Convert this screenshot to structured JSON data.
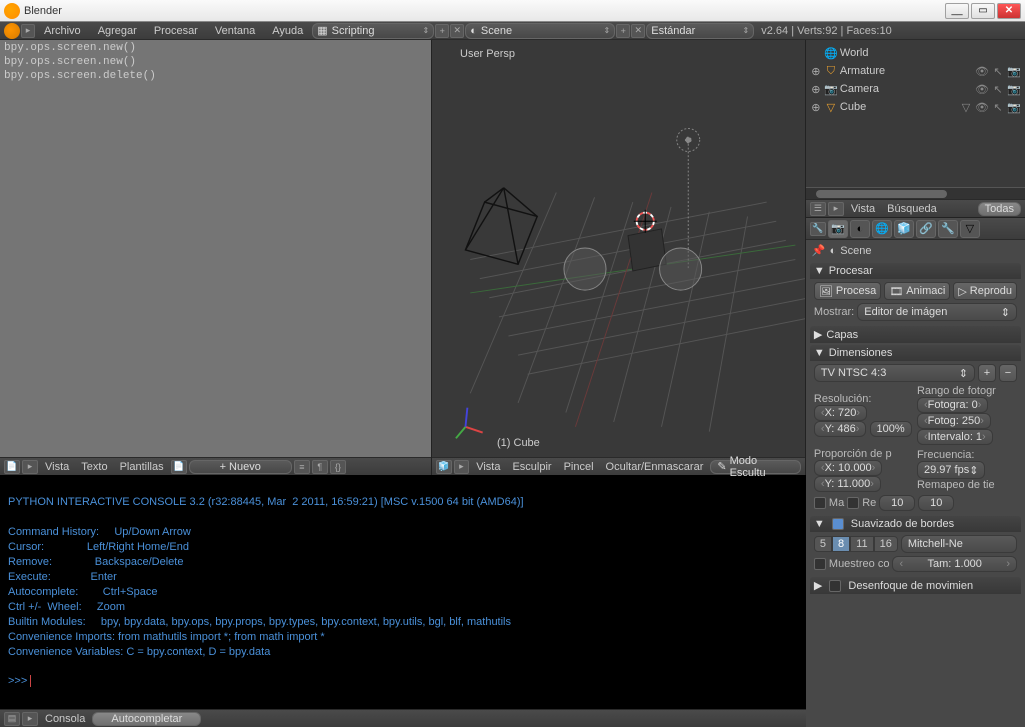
{
  "title": "Blender",
  "menus": {
    "archivo": "Archivo",
    "agregar": "Agregar",
    "procesar": "Procesar",
    "ventana": "Ventana",
    "ayuda": "Ayuda"
  },
  "topbar": {
    "layout": "Scripting",
    "scene": "Scene",
    "engine": "Estándar",
    "stats": "v2.64 | Verts:92 | Faces:10"
  },
  "script_lines": "bpy.ops.screen.new()\nbpy.ops.screen.new()\nbpy.ops.screen.delete()",
  "view3d": {
    "persp": "User Persp",
    "obj": "(1) Cube",
    "menus": {
      "vista": "Vista",
      "esculpir": "Esculpir",
      "pincel": "Pincel",
      "ocultar": "Ocultar/Enmascarar"
    },
    "mode": "Modo Escultu"
  },
  "texteditor_menus": {
    "vista": "Vista",
    "texto": "Texto",
    "plantillas": "Plantillas",
    "nuevo": "Nuevo"
  },
  "console_text": "PYTHON INTERACTIVE CONSOLE 3.2 (r32:88445, Mar  2 2011, 16:59:21) [MSC v.1500 64 bit (AMD64)]\n\nCommand History:     Up/Down Arrow\nCursor:              Left/Right Home/End\nRemove:              Backspace/Delete\nExecute:             Enter\nAutocomplete:        Ctrl+Space\nCtrl +/-  Wheel:     Zoom\nBuiltin Modules:     bpy, bpy.data, bpy.ops, bpy.props, bpy.types, bpy.context, bpy.utils, bgl, blf, mathutils\nConvenience Imports: from mathutils import *; from math import *\nConvenience Variables: C = bpy.context, D = bpy.data\n",
  "console_prompt": ">>> ",
  "console_header": {
    "consola": "Consola",
    "autocompletar": "Autocompletar"
  },
  "outliner": {
    "items": [
      {
        "exp": "",
        "icon": "world",
        "label": "World"
      },
      {
        "exp": "⊕",
        "icon": "armature",
        "label": "Armature"
      },
      {
        "exp": "⊕",
        "icon": "camera",
        "label": "Camera"
      },
      {
        "exp": "⊕",
        "icon": "cube",
        "label": "Cube"
      }
    ],
    "header": {
      "vista": "Vista",
      "busqueda": "Búsqueda",
      "todas": "Todas"
    }
  },
  "props": {
    "breadcrumb": "Scene",
    "procesar": {
      "title": "Procesar",
      "proc": "Procesa",
      "anim": "Animaci",
      "rep": "Reprodu",
      "mostrar": "Mostrar:",
      "display": "Editor de imágen"
    },
    "capas": "Capas",
    "dim": {
      "title": "Dimensiones",
      "preset": "TV NTSC 4:3",
      "reslabel": "Resolución:",
      "x": "X: 720",
      "y": "Y: 486",
      "pct": "100%",
      "rangelabel": "Rango de fotogr",
      "frame_start": "Fotogra: 0",
      "frame_end": "Fotog: 250",
      "interval": "Intervalo: 1",
      "proplabel": "Proporción de p",
      "px": "X: 10.000",
      "py": "Y: 11.000",
      "freclabel": "Frecuencia:",
      "fps": "29.97 fps",
      "remapeo": "Remapeo de tie",
      "ma": "Ma",
      "re": "Re",
      "m1": "10",
      "m2": "10"
    },
    "aa": {
      "title": "Suavizado de bordes",
      "samples": [
        "5",
        "8",
        "11",
        "16"
      ],
      "active": 1,
      "mode": "Mitchell-Ne",
      "muestreo": "Muestreo co",
      "tam": "Tam: 1.000"
    },
    "blur": "Desenfoque de movimien"
  }
}
